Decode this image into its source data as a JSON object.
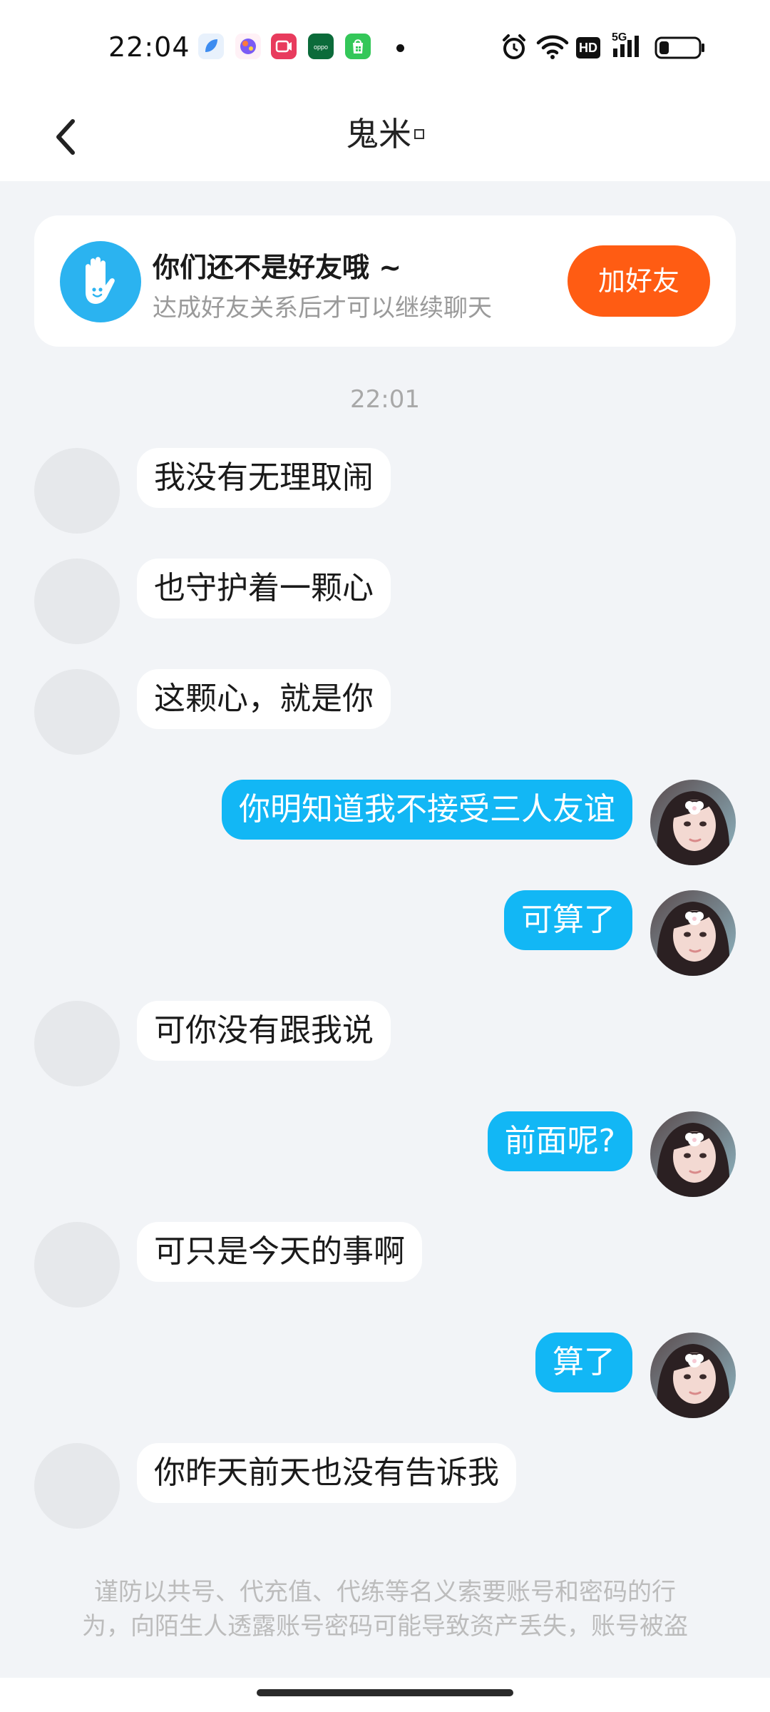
{
  "status_bar": {
    "time": "22:04",
    "icons": [
      "browser-icon",
      "paint-icon",
      "video-icon",
      "oppo-icon",
      "store-icon",
      "alarm-icon",
      "wifi-icon",
      "hd-icon",
      "signal-5g-icon",
      "battery-icon"
    ],
    "hd_label": "HD",
    "network_label": "5G",
    "battery_level": 0.25
  },
  "header": {
    "title": "鬼米"
  },
  "friend_banner": {
    "title": "你们还不是好友哦 ~",
    "subtitle": "达成好友关系后才可以继续聊天",
    "button_label": "加好友",
    "button_color": "#ff5c13"
  },
  "chat": {
    "timestamp": "22:01",
    "messages": [
      {
        "side": "in",
        "text": "我没有无理取闹"
      },
      {
        "side": "in",
        "text": "也守护着一颗心"
      },
      {
        "side": "in",
        "text": "这颗心，就是你"
      },
      {
        "side": "out",
        "text": "你明知道我不接受三人友谊"
      },
      {
        "side": "out",
        "text": "可算了"
      },
      {
        "side": "in",
        "text": "可你没有跟我说"
      },
      {
        "side": "out",
        "text": "前面呢?"
      },
      {
        "side": "in",
        "text": "可只是今天的事啊"
      },
      {
        "side": "out",
        "text": "算了"
      },
      {
        "side": "in",
        "text": "你昨天前天也没有告诉我"
      }
    ]
  },
  "warning": {
    "line1": "谨防以共号、代充值、代练等名义索要账号和密码的行",
    "line2": "为，向陌生人透露账号密码可能导致资产丢失，账号被盗"
  },
  "colors": {
    "outgoing_bubble": "#12b7f5",
    "incoming_bubble": "#ffffff",
    "background": "#f2f4f7"
  }
}
